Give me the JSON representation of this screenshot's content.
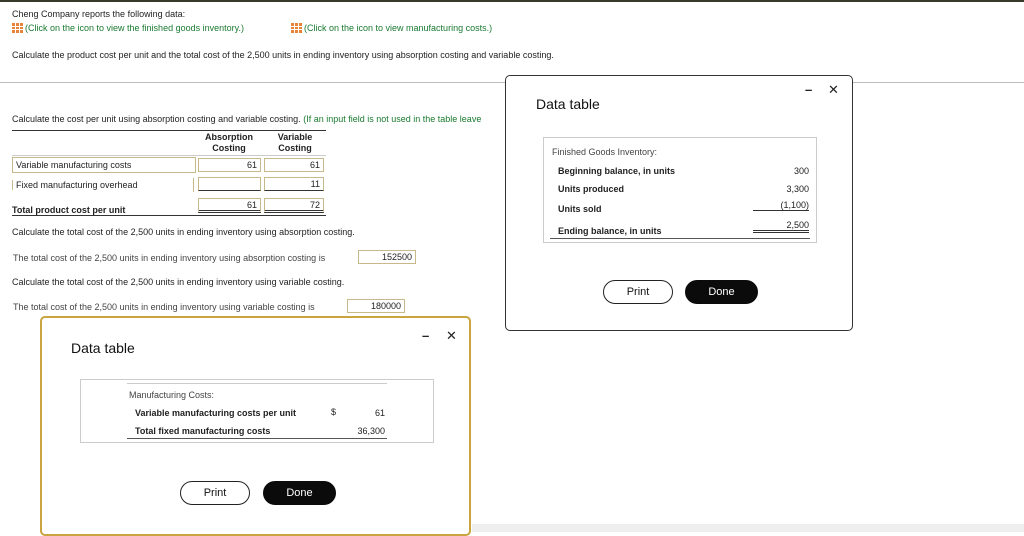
{
  "intro": "Cheng Company reports the following data:",
  "link_inventory": "(Click on the icon to view the finished goods inventory.)",
  "link_costs": "(Click on the icon to view manufacturing costs.)",
  "task": "Calculate the product cost per unit and the total cost of the 2,500 units in ending inventory using absorption costing and variable costing.",
  "section1": {
    "text": "Calculate the cost per unit using absorption costing and variable costing.",
    "hint": "(If an input field is not used in the table leave"
  },
  "table": {
    "col1": "Absorption",
    "col1b": "Costing",
    "col2": "Variable",
    "col2b": "Costing",
    "rows": [
      {
        "label": "Variable manufacturing costs",
        "abs": "61",
        "var": "61"
      },
      {
        "label": "Fixed manufacturing overhead",
        "abs": "",
        "var": "11"
      }
    ],
    "total": {
      "label": "Total product cost per unit",
      "abs": "61",
      "var": "72"
    }
  },
  "q2": "Calculate the total cost of the 2,500 units in ending inventory using absorption costing.",
  "q2_line": "The total cost of the 2,500 units in ending inventory using absorption costing is",
  "q2_value": "152500",
  "q3": "Calculate the total cost of the 2,500 units in ending inventory using variable costing.",
  "q3_line": "The total cost of the 2,500 units in ending inventory using variable costing is",
  "q3_value": "180000",
  "dialog1": {
    "title": "Data table",
    "heading": "Finished Goods Inventory:",
    "rows": [
      {
        "label": "Beginning balance, in units",
        "value": "300"
      },
      {
        "label": "Units produced",
        "value": "3,300"
      },
      {
        "label": "Units sold",
        "value": "(1,100)"
      },
      {
        "label": "Ending balance, in units",
        "value": "2,500"
      }
    ],
    "print": "Print",
    "done": "Done",
    "minimize": "–",
    "close": "✕"
  },
  "dialog2": {
    "title": "Data table",
    "heading": "Manufacturing Costs:",
    "rows": [
      {
        "label": "Variable manufacturing costs per unit",
        "currency": "$",
        "value": "61"
      },
      {
        "label": "Total fixed manufacturing costs",
        "currency": "",
        "value": "36,300"
      }
    ],
    "print": "Print",
    "done": "Done",
    "minimize": "–",
    "close": "✕"
  }
}
